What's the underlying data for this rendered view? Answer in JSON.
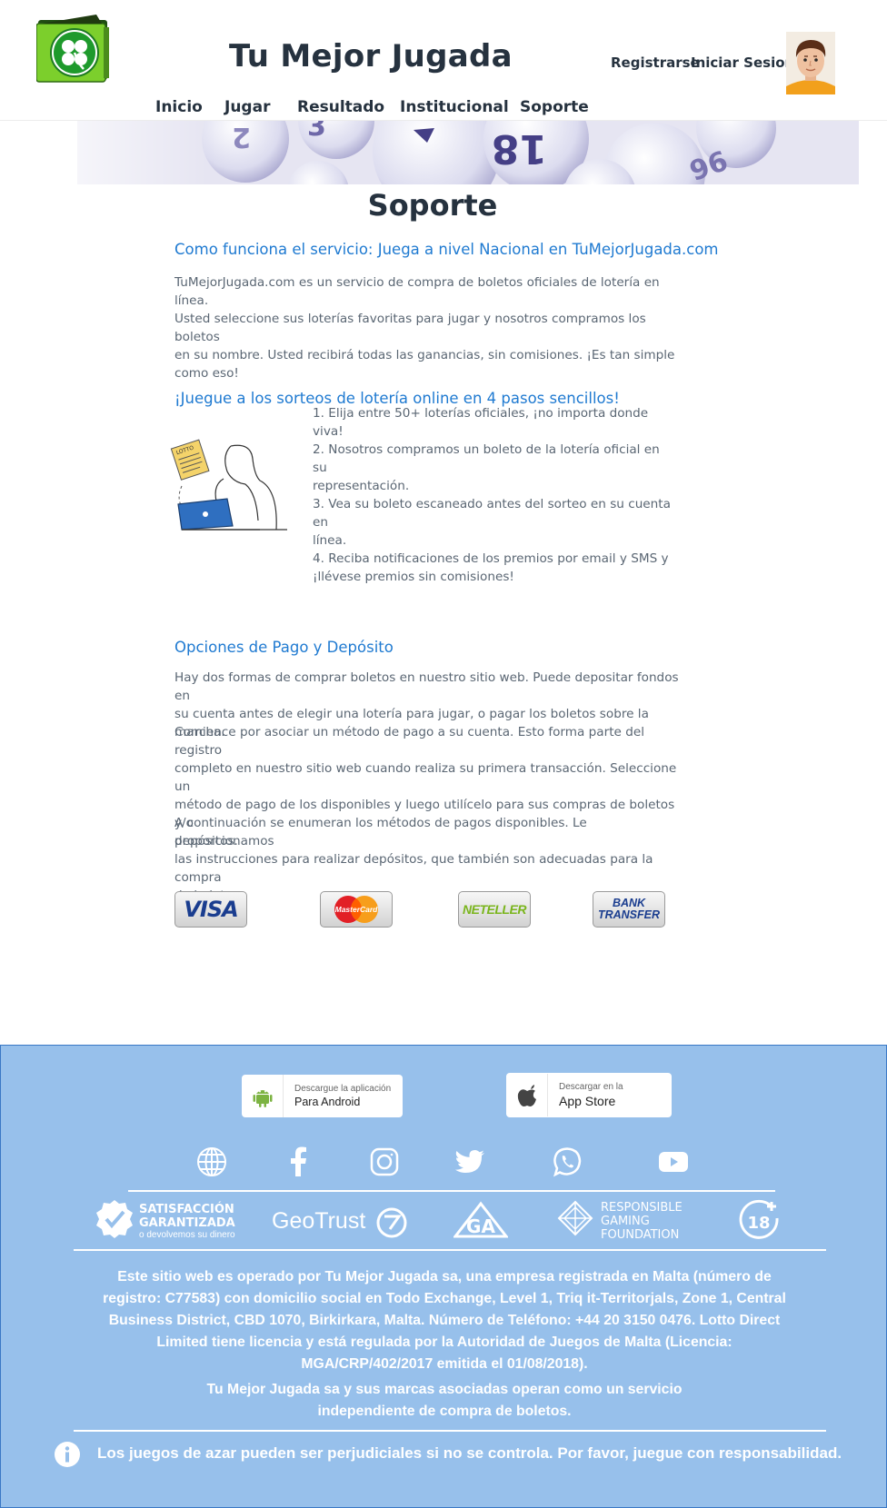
{
  "header": {
    "site_title": "Tu Mejor Jugada",
    "register_label": "Registrarse",
    "login_label": "Iniciar Sesion",
    "logo_icon": "four-leaf-clover-wallet-icon",
    "avatar_icon": "user-avatar-icon"
  },
  "nav": {
    "items": [
      {
        "label": "Inicio"
      },
      {
        "label": "Jugar"
      },
      {
        "label": "Resultado"
      },
      {
        "label": "Institucional"
      },
      {
        "label": "Soporte"
      }
    ]
  },
  "banner": {
    "numbers": [
      "18",
      "3",
      "96",
      "2"
    ]
  },
  "main": {
    "page_title": "Soporte",
    "section1": {
      "heading": "Como funciona el servicio: Juega a nivel Nacional en TuMejorJugada.com",
      "lines": [
        "TuMejorJugada.com es un servicio de compra de boletos oficiales de lotería en línea.",
        "Usted seleccione sus loterías favoritas para jugar y nosotros compramos los boletos",
        "en su nombre. Usted recibirá todas las ganancias, sin comisiones. ¡Es tan simple",
        "como eso!"
      ]
    },
    "section2": {
      "heading": "¡Juegue a los sorteos de lotería online en 4 pasos sencillos!",
      "illustration_label": "LOTTO",
      "steps": [
        [
          "1. Elija entre 50+ loterías oficiales, ¡no importa donde viva!"
        ],
        [
          "2. Nosotros compramos un boleto de la lotería oficial en su",
          "representación."
        ],
        [
          "3. Vea su boleto escaneado antes del sorteo en su cuenta en",
          "línea."
        ],
        [
          "4. Reciba notificaciones de los premios por email y SMS y",
          "¡llévese premios sin comisiones!"
        ]
      ]
    },
    "section3": {
      "heading": "Opciones de Pago y Depósito",
      "paragraphs": [
        [
          "Hay dos formas de comprar boletos en nuestro sitio web. Puede depositar fondos en",
          "su cuenta antes de elegir una lotería para jugar, o pagar los boletos sobre la marcha."
        ],
        [
          "Comience por asociar un método de pago a su cuenta. Esto forma parte del registro",
          "completo en nuestro sitio web cuando realiza su primera transacción. Seleccione un",
          "método de pago de los disponibles y luego utilícelo para sus compras de boletos y/o",
          "depósitos."
        ],
        [
          "A continuación se enumeran los métodos de pagos disponibles. Le proporcionamos",
          "las instrucciones para realizar depósitos, que también son adecuadas para la compra",
          "de boletos"
        ]
      ]
    },
    "payments": {
      "visa": "VISA",
      "mastercard": "MasterCard",
      "neteller": "NETELLER",
      "bank_line1": "BANK",
      "bank_line2": "TRANSFER"
    }
  },
  "footer": {
    "android": {
      "small": "Descargue la aplicación",
      "big": "Para Android"
    },
    "ios": {
      "small": "Descargar en la",
      "big": "App Store"
    },
    "social_icons": [
      "globe-icon",
      "facebook-icon",
      "instagram-icon",
      "twitter-icon",
      "whatsapp-icon",
      "youtube-icon"
    ],
    "trust": {
      "satisfaction_line1": "SATISFACCIÓN",
      "satisfaction_line2": "GARANTIZADA",
      "satisfaction_line3": "o devolvemos su dinero",
      "geotrust": "GeoTrust",
      "ga": "GA",
      "rgf_line1": "RESPONSIBLE",
      "rgf_line2": "GAMING",
      "rgf_line3": "FOUNDATION",
      "age": "18"
    },
    "legal_lines": [
      "Este sitio web es operado por Tu Mejor Jugada sa, una empresa registrada en Malta (número de",
      "registro: C77583) con domicilio social en Todo Exchange, Level 1, Triq it-Territorjals, Zone 1, Central",
      "Business District, CBD 1070, Birkirkara, Malta. Número de Teléfono: +44 20 3150 0476. Lotto Direct",
      "Limited tiene licencia y está regulada por la Autoridad de Juegos de Malta (Licencia:",
      "MGA/CRP/402/2017 emitida el 01/08/2018)."
    ],
    "independent_lines": [
      "Tu Mejor Jugada sa y sus marcas asociadas operan como un servicio",
      "independiente de compra de boletos."
    ],
    "warning": "Los juegos de azar pueden ser perjudiciales si no se controla. Por favor, juegue con responsabilidad."
  }
}
